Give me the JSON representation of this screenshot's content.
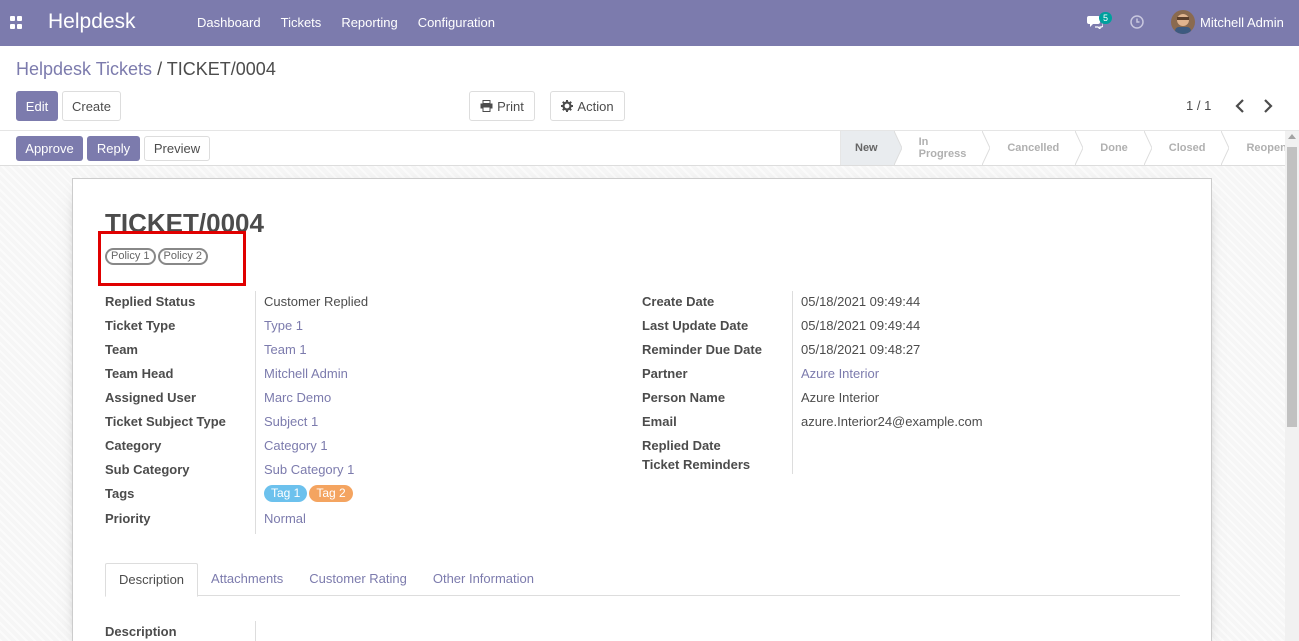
{
  "navbar": {
    "app_name": "Helpdesk",
    "menu": [
      "Dashboard",
      "Tickets",
      "Reporting",
      "Configuration"
    ],
    "message_count": "5",
    "user_name": "Mitchell Admin",
    "icons": [
      "apps-icon",
      "chat-icon",
      "clock-icon"
    ]
  },
  "breadcrumb": {
    "parent": "Helpdesk Tickets",
    "separator": "/",
    "current": "TICKET/0004"
  },
  "control": {
    "edit_label": "Edit",
    "create_label": "Create",
    "print_label": "Print",
    "action_label": "Action",
    "pager": "1 / 1"
  },
  "statusbar": {
    "approve_label": "Approve",
    "reply_label": "Reply",
    "preview_label": "Preview",
    "stages": [
      "New",
      "In Progress",
      "Cancelled",
      "Done",
      "Closed",
      "Reopened"
    ],
    "active_stage": "New"
  },
  "ticket": {
    "title": "TICKET/0004",
    "policies": [
      "Policy 1",
      "Policy 2"
    ],
    "left_fields": {
      "replied_status": {
        "label": "Replied Status",
        "value": "Customer Replied"
      },
      "ticket_type": {
        "label": "Ticket Type",
        "value": "Type 1"
      },
      "team": {
        "label": "Team",
        "value": "Team 1"
      },
      "team_head": {
        "label": "Team Head",
        "value": "Mitchell Admin"
      },
      "assigned_user": {
        "label": "Assigned User",
        "value": "Marc Demo"
      },
      "subject_type": {
        "label": "Ticket Subject Type",
        "value": "Subject 1"
      },
      "category": {
        "label": "Category",
        "value": "Category 1"
      },
      "sub_category": {
        "label": "Sub Category",
        "value": "Sub Category 1"
      },
      "tags": {
        "label": "Tags",
        "values": [
          "Tag 1",
          "Tag 2"
        ],
        "colors": [
          "#6cc1ed",
          "#f4a460"
        ]
      },
      "priority": {
        "label": "Priority",
        "value": "Normal"
      }
    },
    "right_fields": {
      "create_date": {
        "label": "Create Date",
        "value": "05/18/2021 09:49:44"
      },
      "last_update": {
        "label": "Last Update Date",
        "value": "05/18/2021 09:49:44"
      },
      "reminder_due": {
        "label": "Reminder Due Date",
        "value": "05/18/2021 09:48:27"
      },
      "partner": {
        "label": "Partner",
        "value": "Azure Interior"
      },
      "person_name": {
        "label": "Person Name",
        "value": "Azure Interior"
      },
      "email": {
        "label": "Email",
        "value": "azure.Interior24@example.com"
      },
      "replied_date": {
        "label": "Replied Date",
        "value": ""
      },
      "ticket_reminders": {
        "label": "Ticket Reminders",
        "value": ""
      }
    },
    "tabs": [
      "Description",
      "Attachments",
      "Customer Rating",
      "Other Information"
    ],
    "active_tab": "Description",
    "description_label": "Description"
  },
  "colors": {
    "brand": "#7c7bad",
    "highlight": "#e00000"
  }
}
